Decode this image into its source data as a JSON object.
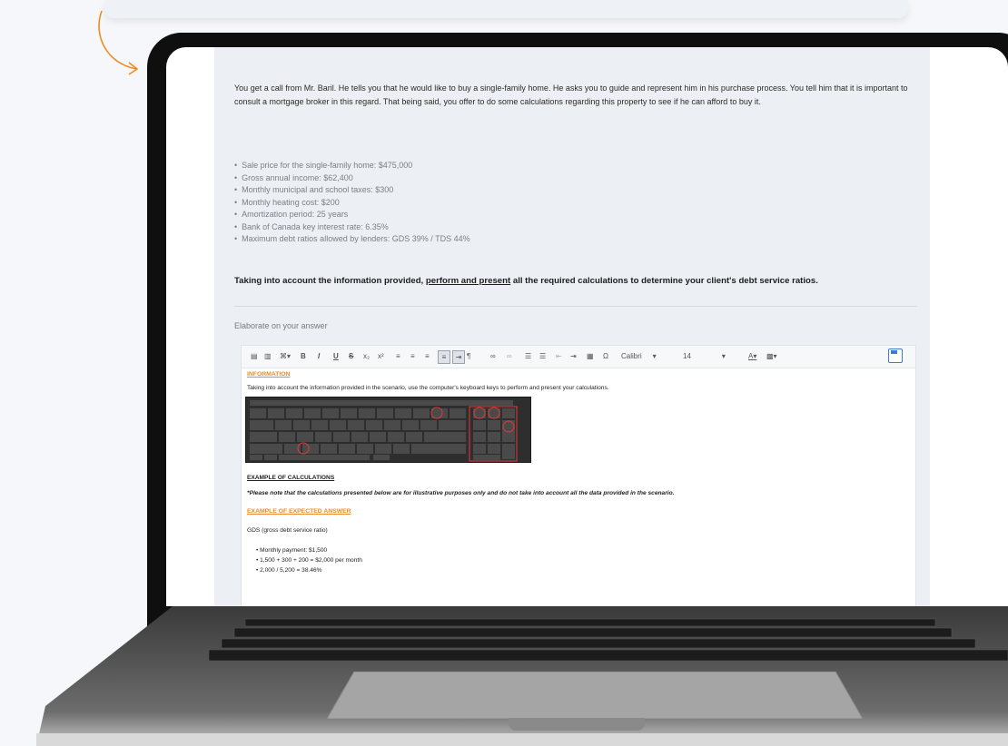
{
  "scenario": {
    "paragraph": "You get a call from Mr. Baril. He tells you that he would like to buy a single-family home. He asks you to guide and represent him in his purchase process. You tell him that it is important to consult a mortgage broker in this regard. That being said, you offer to do some calculations regarding this property to see if he can afford to buy it.",
    "facts": [
      "Sale price for the single-family home: $475,000",
      "Gross annual income: $62,400",
      "Monthly municipal and school taxes: $300",
      "Monthly heating cost: $200",
      "Amortization period: 25 years",
      "Bank of Canada key interest rate: 6.35%",
      "Maximum debt ratios allowed by lenders: GDS 39% / TDS 44%"
    ],
    "task_prefix": "Taking into account the information provided, ",
    "task_underlined": "perform and present",
    "task_suffix": " all the required calculations to determine your client's debt service ratios."
  },
  "answer": {
    "label": "Elaborate on your answer"
  },
  "toolbar": {
    "bold": "B",
    "italic": "I",
    "underline": "U",
    "strike": "S",
    "subscript": "x₂",
    "superscript": "x²",
    "pilcrow": "¶",
    "omega": "Ω",
    "font_name": "Calibri",
    "font_size": "14",
    "text_color": "A"
  },
  "editor": {
    "information_heading": "INFORMATION",
    "information_text": "Taking into account the information provided in the scenario, use the computer's keyboard keys to perform and present your calculations.",
    "example_calc_heading": "EXAMPLE OF CALCULATIONS",
    "note": "*Please note that the calculations presented below are for illustrative purposes only and do not take into account all the data provided in the scenario.",
    "expected_heading": "EXAMPLE OF EXPECTED ANSWER",
    "gds_label": "GDS (gross debt service ratio)",
    "gds_items": [
      "Monthly payment: $1,500",
      "1,500 + 300 + 200 = $2,000 per month",
      "2,000 / 5,200 = 38.46%"
    ]
  },
  "colors": {
    "accent_orange": "#f08a24",
    "panel_bg": "#eceff3",
    "save_blue": "#3b7cd3"
  }
}
